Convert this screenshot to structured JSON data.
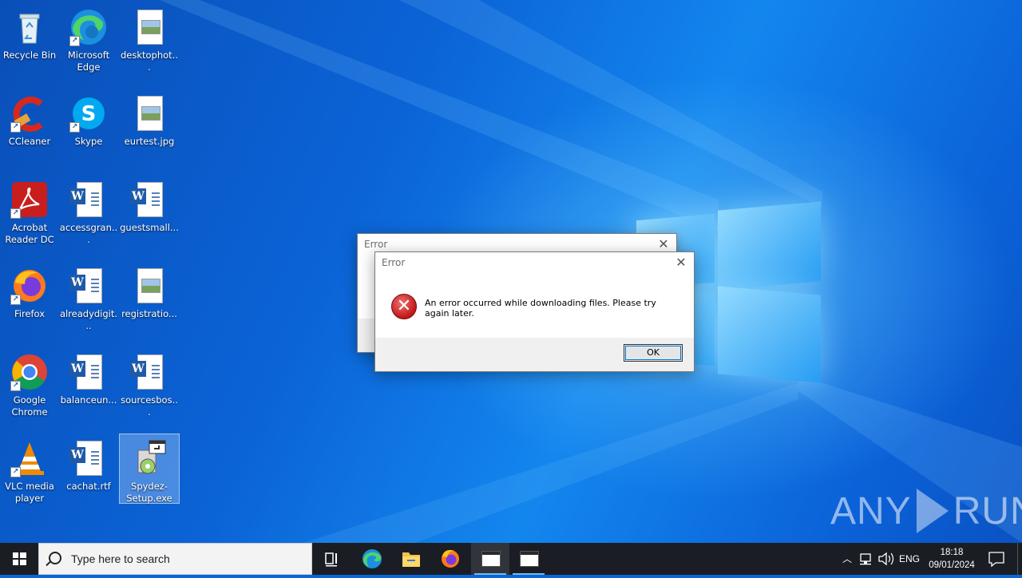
{
  "desktop": {
    "icons": [
      {
        "label": "Recycle Bin"
      },
      {
        "label": "Microsoft Edge"
      },
      {
        "label": "desktophot..."
      },
      {
        "label": "CCleaner"
      },
      {
        "label": "Skype"
      },
      {
        "label": "eurtest.jpg"
      },
      {
        "label": "Acrobat Reader DC"
      },
      {
        "label": "accessgran..."
      },
      {
        "label": "guestsmall..."
      },
      {
        "label": "Firefox"
      },
      {
        "label": "alreadydigit..."
      },
      {
        "label": "registratio..."
      },
      {
        "label": "Google Chrome"
      },
      {
        "label": "balanceun..."
      },
      {
        "label": "sourcesbos..."
      },
      {
        "label": "VLC media player"
      },
      {
        "label": "cachat.rtf"
      },
      {
        "label": "Spydez-Setup.exe"
      }
    ],
    "watermark": {
      "left": "ANY",
      "right": "RUN"
    }
  },
  "dialog_back": {
    "title": "Error"
  },
  "dialog_front": {
    "title": "Error",
    "message": "An error occurred while downloading files. Please try again later.",
    "ok_label": "OK"
  },
  "taskbar": {
    "search_placeholder": "Type here to search",
    "language": "ENG",
    "time": "18:18",
    "date": "09/01/2024"
  },
  "colors": {
    "taskbar": "#1a1e24",
    "accent": "#0078d7",
    "desktop": "#0b63d6"
  }
}
